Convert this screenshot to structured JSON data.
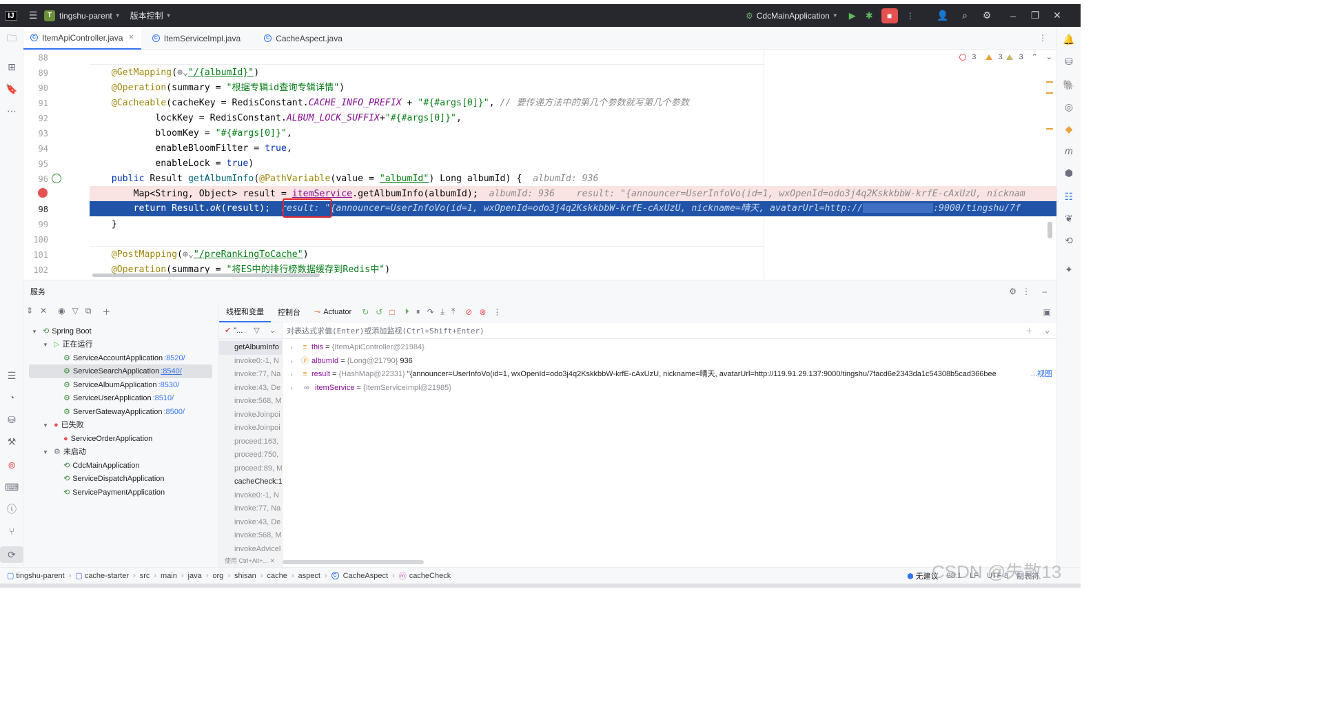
{
  "titlebar": {
    "project_initial": "T",
    "project_name": "tingshu-parent",
    "vcs_label": "版本控制",
    "run_config": "CdcMainApplication"
  },
  "tabs": [
    {
      "label": "ItemApiController.java",
      "active": true
    },
    {
      "label": "ItemServiceImpl.java",
      "active": false
    },
    {
      "label": "CacheAspect.java",
      "active": false
    }
  ],
  "inspections": {
    "errors": "3",
    "warnings": "3",
    "weak_warnings": "3"
  },
  "editor": {
    "line_numbers": [
      "88",
      "89",
      "90",
      "91",
      "92",
      "93",
      "94",
      "95",
      "96",
      "",
      "98",
      "99",
      "100",
      "101",
      "102"
    ],
    "lines": {
      "l89_ann": "@GetMapping",
      "l89_path": "\"/{albumId}\"",
      "l90_ann": "@Operation",
      "l90_rest": "(summary = ",
      "l90_str": "\"根据专辑id查询专辑详情\"",
      "l91_ann": "@Cacheable",
      "l91_a": "(cacheKey = RedisConstant.",
      "l91_field": "CACHE_INFO_PREFIX",
      "l91_b": " + ",
      "l91_str": "\"#{#args[0]}\"",
      "l91_c": ", ",
      "l91_cmt": "// 要传递方法中的第几个参数就写第几个参数",
      "l92_a": "        lockKey = RedisConstant.",
      "l92_field": "ALBUM_LOCK_SUFFIX",
      "l92_b": "+",
      "l92_str": "\"#{#args[0]}\"",
      "l92_c": ",",
      "l93_a": "        bloomKey = ",
      "l93_str": "\"#{#args[0]}\"",
      "l93_c": ",",
      "l94_a": "        enableBloomFilter = ",
      "l94_kw": "true",
      "l94_c": ",",
      "l95_a": "        enableLock = ",
      "l95_kw": "true",
      "l95_c": ")",
      "l96_kw": "public",
      "l96_a": " Result ",
      "l96_m": "getAlbumInfo",
      "l96_b": "(",
      "l96_ann": "@PathVariable",
      "l96_c": "(value = ",
      "l96_str": "\"albumId\"",
      "l96_d": ") Long albumId) {  ",
      "l96_inl": "albumId: 936",
      "l97_a": "    Map<String, Object> result = ",
      "l97_svc": "itemService",
      "l97_b": ".getAlbumInfo(albumId);  ",
      "l97_inl": "albumId: 936    result: \"{announcer=UserInfoVo(id=1, wxOpenId=odo3j4q2KskkbbW-krfE-cAxUzU, nicknam",
      "l98_a": "    return Result.",
      "l98_m": "ok",
      "l98_b": "(result);  ",
      "l98_inl_label": "result:",
      "l98_inl": " \"{announcer=UserInfoVo(id=1, wxOpenId=odo3j4q2KskkbbW-krfE-cAxUzU, nickname=晴天, avatarUrl=http://",
      "l98_inl_tail": ":9000/tingshu/7f",
      "l99": "}",
      "l101_ann": "@PostMapping",
      "l101_path": "\"/preRankingToCache\"",
      "l102_ann": "@Operation",
      "l102_rest": "(summary = ",
      "l102_str": "\"将ES中的排行榜数据缓存到Redis中\"",
      "l102_end": ")"
    }
  },
  "services": {
    "title": "服务",
    "root": "Spring Boot",
    "running_label": "正在运行",
    "running": [
      {
        "name": "ServiceAccountApplication",
        "port": ":8520/"
      },
      {
        "name": "ServiceSearchApplication",
        "port": ":8540/"
      },
      {
        "name": "ServiceAlbumApplication",
        "port": ":8530/"
      },
      {
        "name": "ServiceUserApplication",
        "port": ":8510/"
      },
      {
        "name": "ServerGatewayApplication",
        "port": ":8500/"
      }
    ],
    "failed_label": "已失败",
    "failed": [
      {
        "name": "ServiceOrderApplication"
      }
    ],
    "not_started_label": "未启动",
    "not_started": [
      {
        "name": "CdcMainApplication"
      },
      {
        "name": "ServiceDispatchApplication"
      },
      {
        "name": "ServicePaymentApplication"
      }
    ]
  },
  "debugger": {
    "tab_threads": "线程和变量",
    "tab_console": "控制台",
    "tab_actuator": "Actuator",
    "thread_filter": "\"...",
    "eval_placeholder": "对表达式求值(Enter)或添加监视(Ctrl+Shift+Enter)",
    "frames": [
      "getAlbumInfo",
      "invoke0:-1, N",
      "invoke:77, Na",
      "invoke:43, De",
      "invoke:568, M",
      "invokeJoinpoi",
      "invokeJoinpoi",
      "proceed:163,",
      "proceed:750,",
      "proceed:89, M",
      "cacheCheck:1",
      "invoke0:-1, N",
      "invoke:77, Na",
      "invoke:43, De",
      "invoke:568, M",
      "invokeAdvicel"
    ],
    "frames_hint": "使用 Ctrl+Alt+...",
    "variables": [
      {
        "name": "this",
        "type": "{ItemApiController@21984}",
        "value": ""
      },
      {
        "name": "albumId",
        "type": "{Long@21790}",
        "value": "936"
      },
      {
        "name": "result",
        "type": "{HashMap@22331}",
        "value": "\"{announcer=UserInfoVo(id=1, wxOpenId=odo3j4q2KskkbbW-krfE-cAxUzU, nickname=晴天, avatarUrl=http://119.91.29.137:9000/tingshu/7facd6e2343da1c54308b5cad366bee"
      },
      {
        "name": "itemService",
        "type": "{ItemServiceImpl@21985}",
        "value": ""
      }
    ],
    "view_link": "...视图"
  },
  "statusbar": {
    "breadcrumbs": [
      "tingshu-parent",
      "cache-starter",
      "src",
      "main",
      "java",
      "org",
      "shisan",
      "cache",
      "aspect",
      "CacheAspect",
      "cacheCheck"
    ],
    "ai_label": "无建议",
    "position": "98:1",
    "line_sep": "LF",
    "encoding": "UTF-8",
    "indent": "制表符",
    "watermark": "CSDN @失散13"
  },
  "colors": {
    "accent": "#3574f0",
    "exec_line": "#2154a8",
    "breakpoint_line": "#fae3e3",
    "highlight_box": "#e0262a"
  }
}
